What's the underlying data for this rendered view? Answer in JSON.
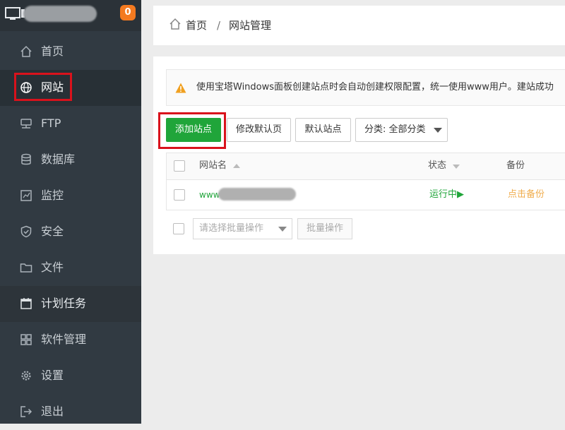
{
  "app": {
    "badge_count": "0"
  },
  "sidebar": {
    "items": [
      {
        "key": "home",
        "label": "首页",
        "icon": "home-icon"
      },
      {
        "key": "website",
        "label": "网站",
        "icon": "globe-icon"
      },
      {
        "key": "ftp",
        "label": "FTP",
        "icon": "ftp-icon"
      },
      {
        "key": "database",
        "label": "数据库",
        "icon": "database-icon"
      },
      {
        "key": "monitor",
        "label": "监控",
        "icon": "chart-icon"
      },
      {
        "key": "security",
        "label": "安全",
        "icon": "shield-icon"
      },
      {
        "key": "files",
        "label": "文件",
        "icon": "folder-icon"
      },
      {
        "key": "cron",
        "label": "计划任务",
        "icon": "calendar-icon"
      },
      {
        "key": "software",
        "label": "软件管理",
        "icon": "grid-icon"
      },
      {
        "key": "settings",
        "label": "设置",
        "icon": "gear-icon"
      },
      {
        "key": "logout",
        "label": "退出",
        "icon": "logout-icon"
      }
    ]
  },
  "breadcrumb": {
    "home": "首页",
    "separator": "/",
    "current": "网站管理"
  },
  "alert": {
    "text": "使用宝塔Windows面板创建站点时会自动创建权限配置，统一使用www用户。建站成功"
  },
  "toolbar": {
    "add_site": "添加站点",
    "default_page": "修改默认页",
    "default_site": "默认站点",
    "category": "分类: 全部分类"
  },
  "table": {
    "columns": [
      "网站名",
      "状态",
      "备份"
    ],
    "rows": [
      {
        "site_prefix": "www",
        "status": "运行中▶",
        "backup": "点击备份"
      }
    ]
  },
  "batch": {
    "select_placeholder": "请选择批量操作",
    "button": "批量操作"
  },
  "colors": {
    "sidebar_bg": "#313a42",
    "accent_green": "#20a53a",
    "badge_orange": "#f47a20",
    "highlight_red": "#d9121c",
    "backup_orange": "#f0ad4e"
  }
}
